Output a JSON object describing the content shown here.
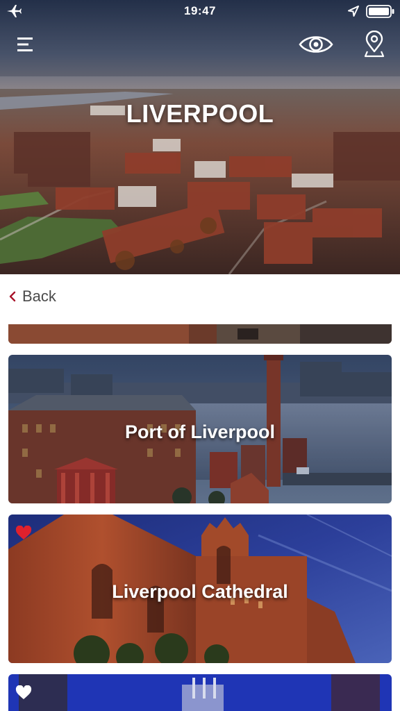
{
  "status_bar": {
    "time": "19:47",
    "icons": [
      "airplane-mode-icon",
      "location-arrow-icon",
      "battery-icon"
    ]
  },
  "header": {
    "city_title": "LIVERPOOL",
    "icons": [
      "hamburger-menu-icon",
      "eye-icon",
      "map-pin-icon"
    ]
  },
  "nav": {
    "back_label": "Back"
  },
  "places": [
    {
      "title": "",
      "favorite": false,
      "partial": true
    },
    {
      "title": "Port of Liverpool",
      "favorite": false
    },
    {
      "title": "Liverpool Cathedral",
      "favorite": true
    },
    {
      "title": "",
      "favorite": false,
      "partial": true
    }
  ],
  "colors": {
    "accent": "#e0212d",
    "back_chevron": "#a8142a",
    "text_muted": "#4a4a4a",
    "background": "#ffffff"
  }
}
